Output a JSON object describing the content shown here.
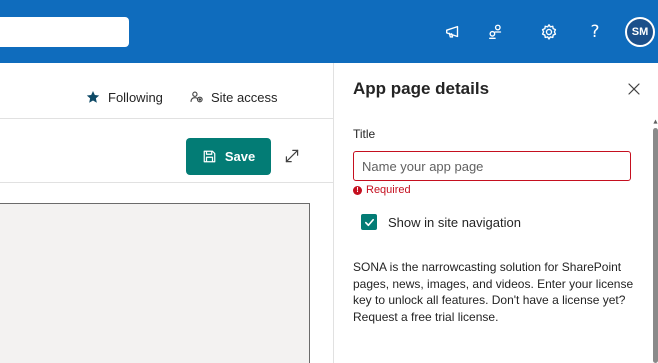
{
  "suitebar": {
    "search_placeholder": "",
    "icons": [
      "megaphone-icon",
      "people-connect-icon",
      "settings-icon",
      "help-icon"
    ],
    "help_label": "?",
    "avatar_initials": "SM",
    "colors": {
      "background": "#0f6cbd",
      "avatar_bg": "#1b4f8a"
    }
  },
  "commandbar": {
    "following_label": "Following",
    "site_access_label": "Site access"
  },
  "toolbar": {
    "save_label": "Save",
    "save_color": "#037c75"
  },
  "panel": {
    "title": "App page details",
    "title_field_label": "Title",
    "title_input_value": "",
    "title_input_placeholder": "Name your app page",
    "required_text": "Required",
    "show_in_nav_label": "Show in site navigation",
    "show_in_nav_checked": true,
    "description": "SONA is the narrowcasting solution for SharePoint pages, news, images, and videos. Enter your license key to unlock all features. Don't have a license yet? Request a free trial license.",
    "error_color": "#c50f1f"
  }
}
